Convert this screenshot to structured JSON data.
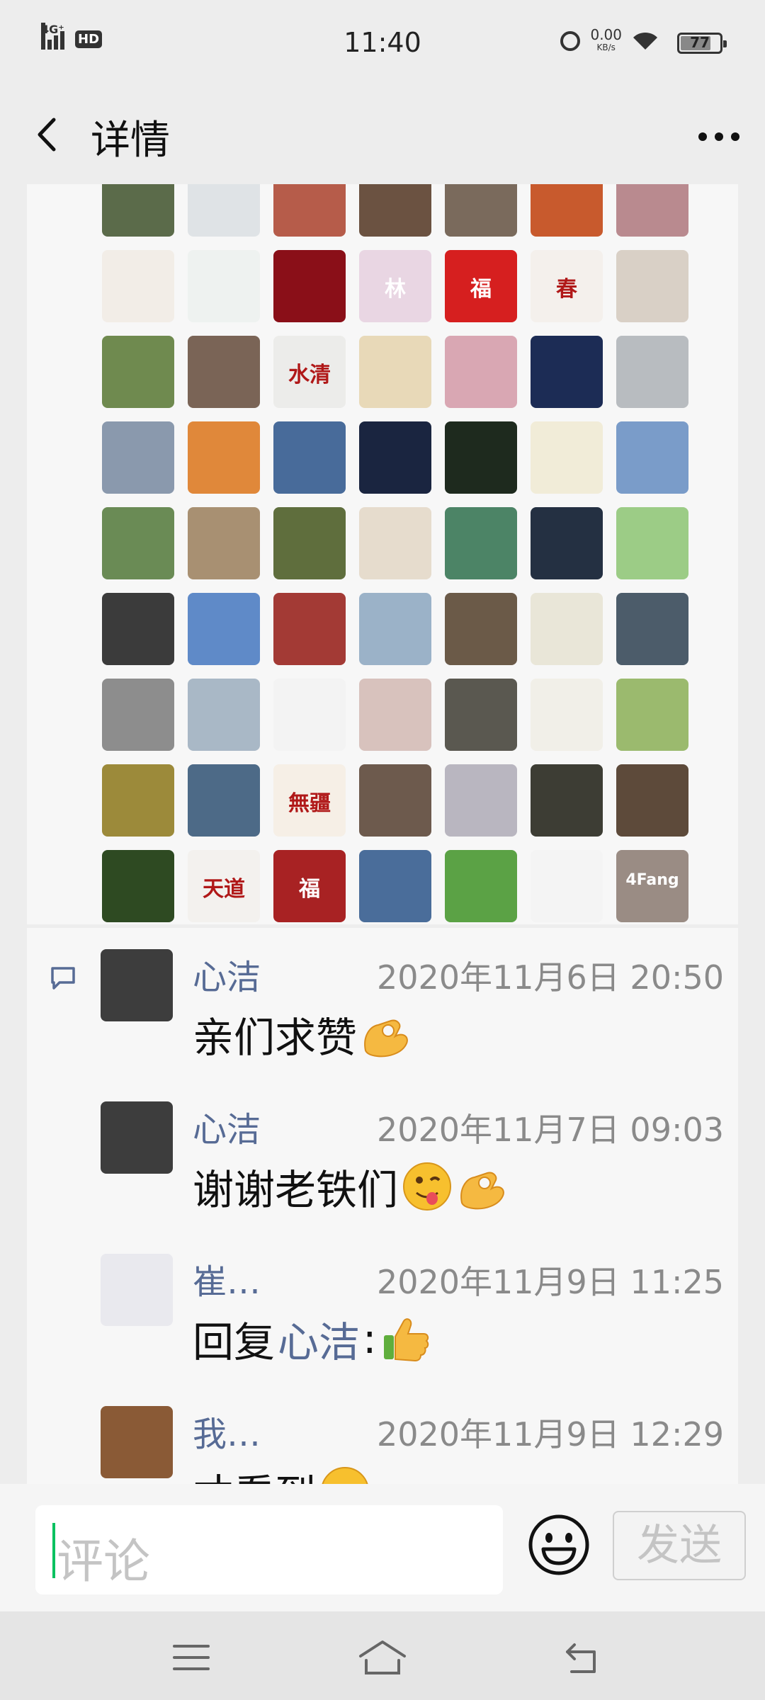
{
  "status_bar": {
    "network": "4G⁺",
    "hd": "HD",
    "time": "11:40",
    "speed_value": "0.00",
    "speed_unit": "KB/s",
    "battery": "77"
  },
  "header": {
    "title": "详情"
  },
  "likes": {
    "rows": 9,
    "avatars": [
      {
        "bg": "#5b6b4a"
      },
      {
        "bg": "#dfe3e6"
      },
      {
        "bg": "#b65c4a"
      },
      {
        "bg": "#6b5241"
      },
      {
        "bg": "#7a6a5c"
      },
      {
        "bg": "#c85a2d"
      },
      {
        "bg": "#b98a8f"
      },
      {
        "bg": "#f2ede7"
      },
      {
        "bg": "#eef2f0"
      },
      {
        "bg": "#8a0f18"
      },
      {
        "bg": "#e9d6e3",
        "text": "林"
      },
      {
        "bg": "#d61f1f",
        "text": "福"
      },
      {
        "bg": "#f4f0ec",
        "text": "春"
      },
      {
        "bg": "#d9d0c6"
      },
      {
        "bg": "#6f8a4f"
      },
      {
        "bg": "#7a6456"
      },
      {
        "bg": "#ececea",
        "text": "水清"
      },
      {
        "bg": "#e8d9b8"
      },
      {
        "bg": "#d9a7b3"
      },
      {
        "bg": "#1c2c55"
      },
      {
        "bg": "#b8bcc0"
      },
      {
        "bg": "#8a99ad"
      },
      {
        "bg": "#e0883a"
      },
      {
        "bg": "#486b9a"
      },
      {
        "bg": "#1a2540"
      },
      {
        "bg": "#1e2a1e"
      },
      {
        "bg": "#f1ecd8"
      },
      {
        "bg": "#7a9cc9"
      },
      {
        "bg": "#6a8b55"
      },
      {
        "bg": "#a89072"
      },
      {
        "bg": "#5f6e3d"
      },
      {
        "bg": "#e6dccd"
      },
      {
        "bg": "#4c8466"
      },
      {
        "bg": "#243042"
      },
      {
        "bg": "#9ccc86"
      },
      {
        "bg": "#3b3b3b"
      },
      {
        "bg": "#5f8ac8"
      },
      {
        "bg": "#a33a35"
      },
      {
        "bg": "#9bb2c8"
      },
      {
        "bg": "#6b5a48"
      },
      {
        "bg": "#e9e6d8"
      },
      {
        "bg": "#4c5c6a"
      },
      {
        "bg": "#8d8d8d"
      },
      {
        "bg": "#a9b8c6"
      },
      {
        "bg": "#f3f3f3"
      },
      {
        "bg": "#d8c2bd"
      },
      {
        "bg": "#5a5850"
      },
      {
        "bg": "#f1efe8"
      },
      {
        "bg": "#9bba6e"
      },
      {
        "bg": "#9c8a3a"
      },
      {
        "bg": "#4d6a87"
      },
      {
        "bg": "#f6efe6",
        "text": "無疆"
      },
      {
        "bg": "#6d5a4d"
      },
      {
        "bg": "#b9b6c0"
      },
      {
        "bg": "#3d3d34"
      },
      {
        "bg": "#5d4a3a"
      },
      {
        "bg": "#2e4a22"
      },
      {
        "bg": "#f3f1ee",
        "text": "天道"
      },
      {
        "bg": "#a82223",
        "text": "福"
      },
      {
        "bg": "#4a6d9a"
      },
      {
        "bg": "#5ba245"
      },
      {
        "bg": "#f4f4f4"
      },
      {
        "bg": "#9a8c84",
        "text": "4Fang"
      }
    ]
  },
  "comments": [
    {
      "name": "心洁",
      "time": "2020年11月6日 20:50",
      "text": "亲们求赞",
      "emojis": [
        "ok-hand"
      ],
      "avatar_bg": "#3d3d3d"
    },
    {
      "name": "心洁",
      "time": "2020年11月7日 09:03",
      "text": "谢谢老铁们",
      "emojis": [
        "winking-tongue",
        "ok-hand"
      ],
      "avatar_bg": "#3d3d3d"
    },
    {
      "name": "崔…",
      "time": "2020年11月9日 11:25",
      "text_prefix": "回复",
      "text_link": "心洁",
      "text_suffix": ":",
      "emojis": [
        "thumbs-up"
      ],
      "avatar_bg": "#e9e9ee"
    },
    {
      "name": "我…",
      "time": "2020年11月9日 12:29",
      "text": "才看到",
      "emojis": [
        "smile"
      ],
      "avatar_bg": "#8a5a36"
    }
  ],
  "input": {
    "placeholder": "评论",
    "send_label": "发送"
  },
  "colors": {
    "link": "#576b95",
    "accent": "#07c160",
    "background": "#ededed"
  }
}
